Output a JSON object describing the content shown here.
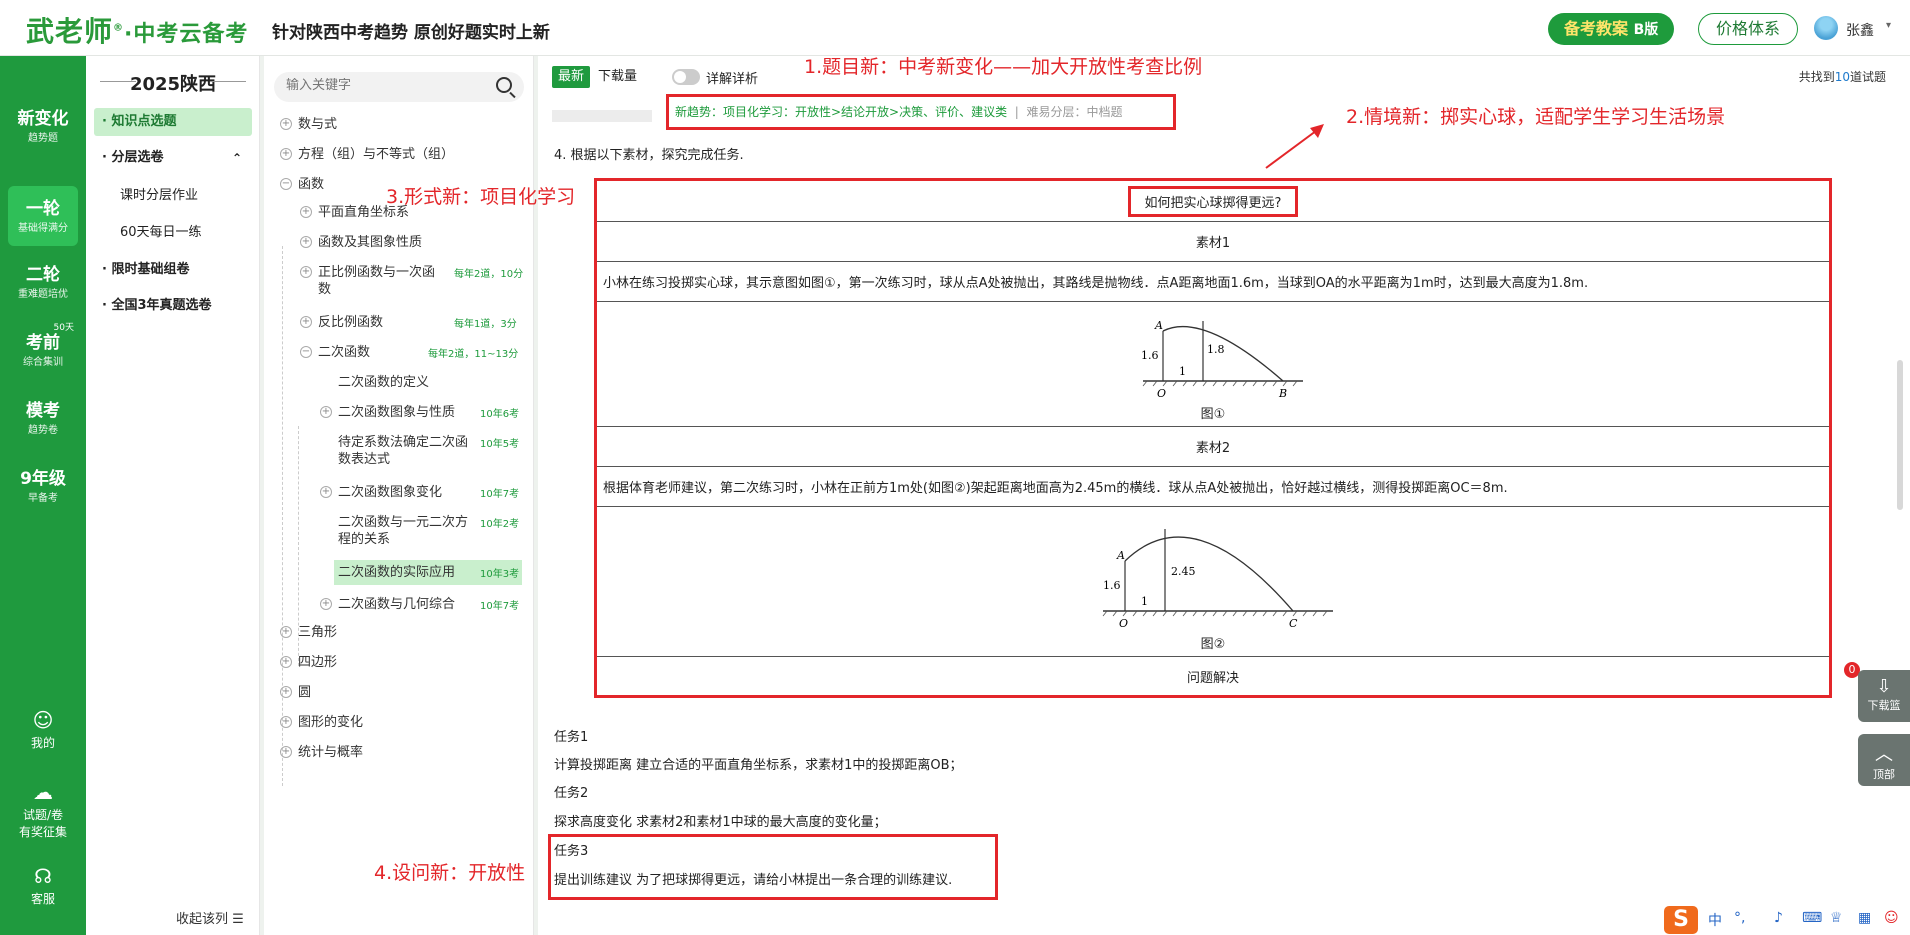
{
  "header": {
    "logo_main": "武老师",
    "logo_dot": "®",
    "logo_sub": "·中考云备考",
    "tagline": "针对陕西中考趋势 原创好题实时上新",
    "plan_button": "备考教案",
    "plan_button_suffix": "B版",
    "price_button": "价格体系",
    "user_name": "张鑫",
    "user_caret": "▾"
  },
  "leftnav": {
    "items": [
      {
        "title": "新变化",
        "sub": "趋势题"
      },
      {
        "title": "一轮",
        "sub": "基础得满分"
      },
      {
        "title": "二轮",
        "sub": "重难题培优"
      },
      {
        "title": "考前",
        "sub": "综合集训",
        "badge": "50天"
      },
      {
        "title": "模考",
        "sub": "趋势卷"
      },
      {
        "title": "9年级",
        "sub": "早备考"
      }
    ],
    "bottom": [
      {
        "label": "我的",
        "icon": "☺"
      },
      {
        "label": "试题/卷\n有奖征集",
        "line1": "试题/卷",
        "line2": "有奖征集",
        "icon": "☁"
      },
      {
        "label": "客服",
        "icon": "☊"
      }
    ]
  },
  "col2": {
    "title": "2025陕西",
    "items": [
      {
        "label": "· 知识点选题",
        "active": true
      },
      {
        "label": "· 分层选卷",
        "caret": "⌃"
      },
      {
        "label": "课时分层作业"
      },
      {
        "label": "60天每日一练"
      },
      {
        "label": "· 限时基础组卷"
      },
      {
        "label": "· 全国3年真题选卷"
      }
    ],
    "collapse_label": "收起该列",
    "collapse_icon": "☰"
  },
  "tree": {
    "search_placeholder": "输入关键字",
    "nodes": [
      {
        "label": "数与式",
        "tog": "+"
      },
      {
        "label": "方程（组）与不等式（组）",
        "tog": "+"
      },
      {
        "label": "函数",
        "tog": "−"
      },
      {
        "label": "平面直角坐标系",
        "tog": "+"
      },
      {
        "label": "函数及其图象性质",
        "tog": "+"
      },
      {
        "label": "正比例函数与一次函",
        "label2": "数",
        "tog": "+",
        "meta": "每年2道，10分"
      },
      {
        "label": "反比例函数",
        "tog": "+",
        "meta": "每年1道，3分"
      },
      {
        "label": "二次函数",
        "tog": "−",
        "meta": "每年2道，11~13分"
      },
      {
        "label": "二次函数的定义"
      },
      {
        "label": "二次函数图象与性质",
        "tog": "+",
        "meta": "10年6考"
      },
      {
        "label": "待定系数法确定二次函",
        "label2": "数表达式",
        "meta": "10年5考"
      },
      {
        "label": "二次函数图象变化",
        "tog": "+",
        "meta": "10年7考"
      },
      {
        "label": "二次函数与一元二次方",
        "label2": "程的关系",
        "meta": "10年2考"
      },
      {
        "label": "二次函数的实际应用",
        "meta": "10年3考",
        "highlight": true
      },
      {
        "label": "二次函数与几何综合",
        "tog": "+",
        "meta": "10年7考"
      },
      {
        "label": "三角形",
        "tog": "+"
      },
      {
        "label": "四边形",
        "tog": "+"
      },
      {
        "label": "圆",
        "tog": "+"
      },
      {
        "label": "图形的变化",
        "tog": "+"
      },
      {
        "label": "统计与概率",
        "tog": "+"
      }
    ]
  },
  "main": {
    "tab_latest": "最新",
    "tab_download": "下载量",
    "toggle_label": "详解详析",
    "found_prefix": "共找到",
    "found_count": "10",
    "found_suffix": "道试题",
    "trend_text": "新趋势：项目化学习：开放性>结论开放>决策、评价、建议类",
    "difficulty": "难易分层：中档题",
    "question_intro": "4. 根据以下素材，探究完成任务.",
    "table_title": "如何把实心球掷得更远?",
    "material1_title": "素材1",
    "material1_text": "小林在练习投掷实心球，其示意图如图①，第一次练习时，球从点A处被抛出，其路线是抛物线．点A距离地面1.6m，当球到OA的水平距离为1m时，达到最大高度为1.8m.",
    "fig1_caption": "图①",
    "fig1_labels": {
      "A": "A",
      "O": "O",
      "B": "B",
      "h1": "1.6",
      "h2": "1.8",
      "d": "1"
    },
    "material2_title": "素材2",
    "material2_text": "根据体育老师建议，第二次练习时，小林在正前方1m处(如图②)架起距离地面高为2.45m的横线．球从点A处被抛出，恰好越过横线，测得投掷距离OC＝8m.",
    "fig2_caption": "图②",
    "fig2_labels": {
      "A": "A",
      "O": "O",
      "C": "C",
      "h1": "1.6",
      "h2": "2.45",
      "d": "1"
    },
    "problem_solving": "问题解决",
    "tasks": [
      {
        "title": "任务1",
        "text": "计算投掷距离 建立合适的平面直角坐标系，求素材1中的投掷距离OB；"
      },
      {
        "title": "任务2",
        "text": "探求高度变化 求素材2和素材1中球的最大高度的变化量；"
      },
      {
        "title": "任务3",
        "text": "提出训练建议 为了把球掷得更远，请给小林提出一条合理的训练建议."
      }
    ]
  },
  "annotations": {
    "a1": "1.题目新：中考新变化——加大开放性考查比例",
    "a2": "2.情境新：掷实心球，适配学生学习生活场景",
    "a3": "3.形式新：项目化学习",
    "a4": "4.设问新：开放性",
    "accent": "#e3262a"
  },
  "floating": {
    "download_label": "下载篮",
    "download_badge": "0",
    "top_label": "顶部"
  },
  "ime": {
    "logo": "S",
    "lang": "中",
    "punct": "°,",
    "icons": [
      "mic-icon",
      "keyboard-icon",
      "shirt-icon",
      "grid-icon",
      "smile-icon"
    ]
  },
  "colors": {
    "brand_green": "#1f9a3e",
    "highlight_green": "#c9efcd",
    "annotation_red": "#e3262a"
  }
}
